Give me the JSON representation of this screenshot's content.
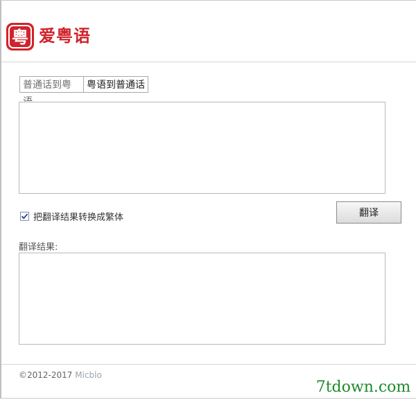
{
  "app": {
    "name": "爱粤语",
    "logo_glyph": "粤",
    "brand_color": "#d0242c"
  },
  "tabs": [
    {
      "label": "普通话到粤语",
      "active": true
    },
    {
      "label": "粤语到普通话",
      "active": false
    }
  ],
  "input": {
    "value": "",
    "placeholder": ""
  },
  "options": {
    "traditional_label": "把翻译结果转换成繁体",
    "traditional_checked": true
  },
  "actions": {
    "translate_label": "翻译"
  },
  "result": {
    "label": "翻译结果:",
    "value": ""
  },
  "footer": {
    "copyright": "©2012-2017",
    "brand": "Micblo"
  },
  "watermark": {
    "text": "7tdown.com",
    "color": "#1e8a2a"
  }
}
